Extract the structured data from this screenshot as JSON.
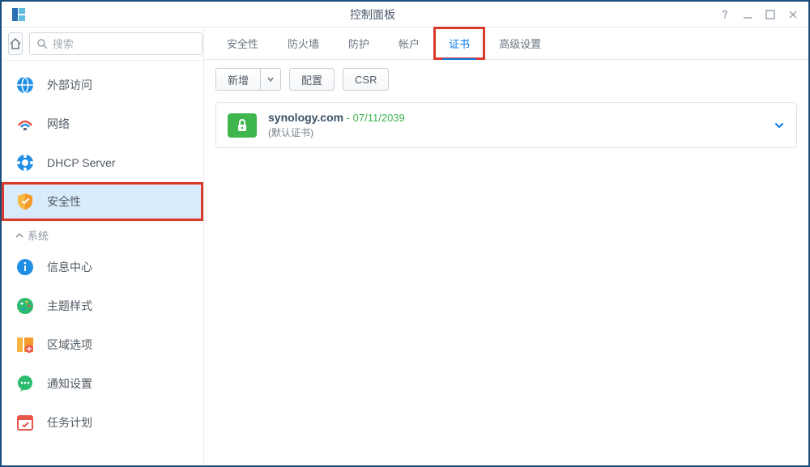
{
  "window": {
    "title": "控制面板"
  },
  "search": {
    "placeholder": "搜索"
  },
  "sidebar": {
    "items": [
      {
        "label": "外部访问"
      },
      {
        "label": "网络"
      },
      {
        "label": "DHCP Server"
      },
      {
        "label": "安全性"
      }
    ],
    "group_label": "系统",
    "system_items": [
      {
        "label": "信息中心"
      },
      {
        "label": "主题样式"
      },
      {
        "label": "区域选项"
      },
      {
        "label": "通知设置"
      },
      {
        "label": "任务计划"
      }
    ]
  },
  "tabs": [
    {
      "label": "安全性"
    },
    {
      "label": "防火墙"
    },
    {
      "label": "防护"
    },
    {
      "label": "帐户"
    },
    {
      "label": "证书"
    },
    {
      "label": "高级设置"
    }
  ],
  "toolbar": {
    "new_label": "新增",
    "config_label": "配置",
    "csr_label": "CSR"
  },
  "certificate": {
    "domain": "synology.com",
    "expiry": " - 07/11/2039",
    "default_label": "(默认证书)"
  }
}
